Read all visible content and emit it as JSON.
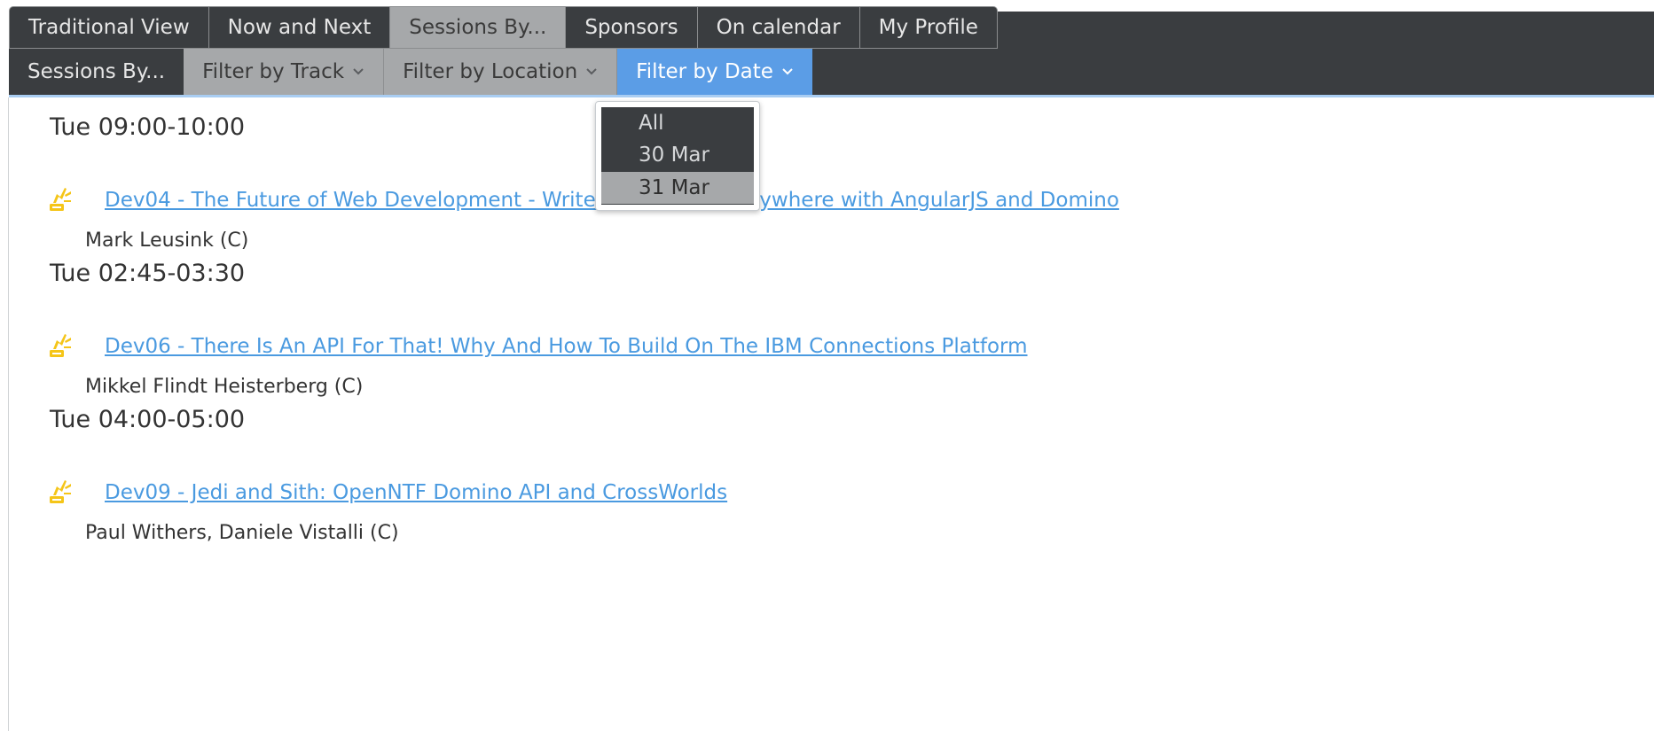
{
  "top_tabs": [
    {
      "label": "Traditional View"
    },
    {
      "label": "Now and Next"
    },
    {
      "label": "Sessions By..."
    },
    {
      "label": "Sponsors"
    },
    {
      "label": "On calendar"
    },
    {
      "label": "My Profile"
    }
  ],
  "sub_nav": {
    "sessions_by": "Sessions By...",
    "filter_track": "Filter by Track",
    "filter_location": "Filter by Location",
    "filter_date": "Filter by Date"
  },
  "date_dropdown": {
    "options": [
      "All",
      "30 Mar",
      "31 Mar"
    ],
    "selected": "31 Mar"
  },
  "sessions": [
    {
      "time": "Tue 09:00-10:00",
      "title": "Dev04 - The Future of Web Development - Write Once, Run Everywhere with AngularJS and Domino",
      "speakers": "Mark Leusink (C)"
    },
    {
      "time": "Tue 02:45-03:30",
      "title": "Dev06 - There Is An API For That! Why And How To Build On The IBM Connections Platform",
      "speakers": "Mikkel Flindt Heisterberg (C)"
    },
    {
      "time": "Tue 04:00-05:00",
      "title": "Dev09 - Jedi and Sith: OpenNTF Domino API and CrossWorlds",
      "speakers": "Paul Withers, Daniele Vistalli (C)"
    }
  ],
  "colors": {
    "nav_dark": "#3a3d40",
    "nav_active_grey": "#a6a8aa",
    "accent_blue": "#5b9de6",
    "link_blue": "#4a9ae0",
    "session_icon": "#f5c518"
  },
  "icons": {
    "session": "session-icon",
    "chevron": "chevron-down-icon"
  }
}
